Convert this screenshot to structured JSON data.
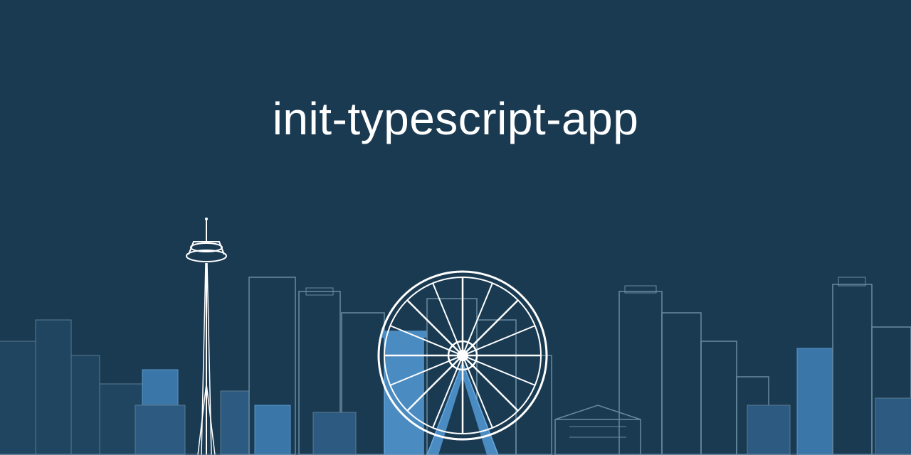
{
  "title": "init-typescript-app",
  "colors": {
    "background": "#1a3a52",
    "text": "#ffffff",
    "building_fill": "#2d5a80",
    "building_accent": "#4a8bc2",
    "outline": "#ffffff"
  }
}
